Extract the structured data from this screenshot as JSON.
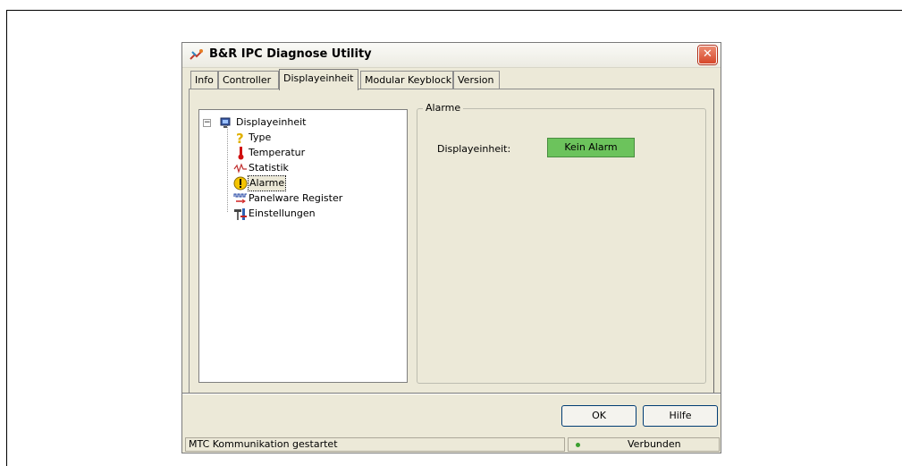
{
  "window": {
    "title": "B&R IPC Diagnose Utility",
    "close_glyph": "✕"
  },
  "tabs": [
    {
      "label": "Info"
    },
    {
      "label": "Controller"
    },
    {
      "label": "Displayeinheit",
      "active": true
    },
    {
      "label": "Modular Keyblock"
    },
    {
      "label": "Version"
    }
  ],
  "tree": {
    "root": {
      "label": "Displayeinheit",
      "icon": "monitor-icon",
      "expander": "−"
    },
    "children": [
      {
        "label": "Type",
        "icon": "question-icon"
      },
      {
        "label": "Temperatur",
        "icon": "thermometer-icon"
      },
      {
        "label": "Statistik",
        "icon": "waveform-icon"
      },
      {
        "label": "Alarme",
        "icon": "warning-icon",
        "selected": true
      },
      {
        "label": "Panelware Register",
        "icon": "register-icon"
      },
      {
        "label": "Einstellungen",
        "icon": "tools-icon"
      }
    ]
  },
  "alarm_group": {
    "legend": "Alarme",
    "field_label": "Displayeinheit:",
    "value": "Kein Alarm",
    "value_color": "#6cc35c"
  },
  "buttons": {
    "ok": "OK",
    "help": "Hilfe"
  },
  "status": {
    "message": "MTC Kommunikation gestartet",
    "connection": "Verbunden",
    "led_color": "#3ba02f"
  }
}
